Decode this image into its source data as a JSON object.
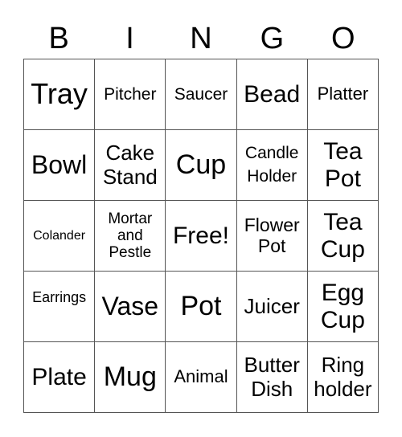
{
  "header": [
    "B",
    "I",
    "N",
    "G",
    "O"
  ],
  "cells": [
    "Tray",
    "Pitcher",
    "Saucer",
    "Bead",
    "Platter",
    "Bowl",
    "Cake Stand",
    "Cup",
    "Candle Holder",
    "Tea Pot",
    "Colander",
    "Mortar and Pestle",
    "Free!",
    "Flower Pot",
    "Tea Cup",
    "Earrings",
    "Vase",
    "Pot",
    "Juicer",
    "Egg Cup",
    "Plate",
    "Mug",
    "Animal",
    "Butter Dish",
    "Ring holder"
  ]
}
